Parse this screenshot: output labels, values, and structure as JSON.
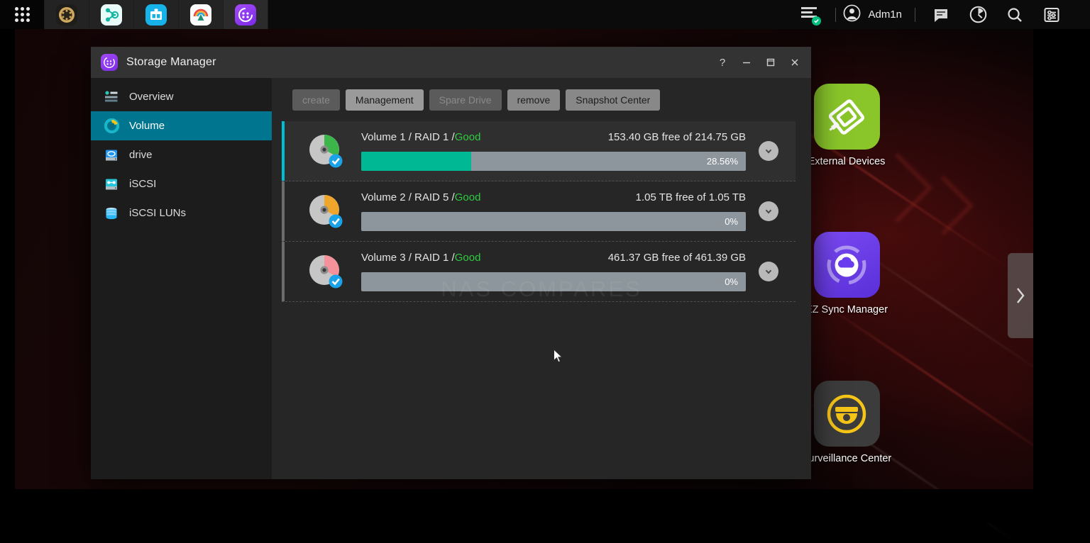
{
  "taskbar": {
    "app_icons": [
      {
        "name": "app-menu-grid-icon",
        "label": "Main Menu"
      },
      {
        "name": "control-panel-icon",
        "label": "Control Panel"
      },
      {
        "name": "network-topology-icon",
        "label": "Network"
      },
      {
        "name": "app-center-icon",
        "label": "App Center"
      },
      {
        "name": "photo-station-icon",
        "label": "Photo Station"
      },
      {
        "name": "storage-manager-icon",
        "label": "Storage Manager"
      }
    ],
    "status_icon": "system-status-icon",
    "user": "Adm1n",
    "user_avatar_icon": "user-avatar-icon",
    "right_icons": [
      {
        "name": "chat-icon",
        "label": "Notifications"
      },
      {
        "name": "resource-monitor-icon",
        "label": "Resource Monitor"
      },
      {
        "name": "search-icon",
        "label": "Search"
      },
      {
        "name": "settings-icon",
        "label": "Settings"
      }
    ]
  },
  "desktop": {
    "icons": [
      {
        "name": "external-devices",
        "label": "External Devices",
        "icon": "usb-device-icon",
        "color": "#8ac62a"
      },
      {
        "name": "ez-sync-manager",
        "label": "EZ Sync Manager",
        "icon": "cloud-sync-icon",
        "color": "#6a3df0"
      },
      {
        "name": "surveillance-center",
        "label": "Surveillance Center",
        "icon": "dome-camera-icon",
        "color": "#3c3c3c"
      }
    ],
    "edge_handle_icon": "chevron-right-icon"
  },
  "window": {
    "title": "Storage Manager",
    "app_icon": "storage-manager-icon",
    "controls": {
      "help": "?",
      "minimize": "—",
      "maximize": "☐",
      "close": "✕"
    },
    "watermark": "NAS COMPARES"
  },
  "sidebar": {
    "items": [
      {
        "label": "Overview",
        "icon": "overview-icon",
        "selected": false
      },
      {
        "label": "Volume",
        "icon": "volume-icon",
        "selected": true
      },
      {
        "label": "drive",
        "icon": "drive-icon",
        "selected": false
      },
      {
        "label": "iSCSI",
        "icon": "iscsi-icon",
        "selected": false
      },
      {
        "label": "iSCSI LUNs",
        "icon": "iscsi-lun-icon",
        "selected": false
      }
    ]
  },
  "toolbar": {
    "buttons": [
      {
        "label": "create",
        "state": "disabled"
      },
      {
        "label": "Management",
        "state": "enabled"
      },
      {
        "label": "Spare Drive",
        "state": "disabled"
      },
      {
        "label": "remove",
        "state": "mid"
      },
      {
        "label": "Snapshot Center",
        "state": "mid"
      }
    ]
  },
  "volumes": [
    {
      "name": "Volume 1 / RAID 1 / ",
      "status": "Good",
      "capacity": "153.40 GB free of 214.75 GB",
      "percent_label": "28.56%",
      "percent_value": 28.56,
      "wedge_color": "#3cb54a",
      "selected": true,
      "expand_icon": "chevron-down-icon"
    },
    {
      "name": "Volume 2 / RAID 5 / ",
      "status": "Good",
      "capacity": "1.05 TB free of 1.05 TB",
      "percent_label": "0%",
      "percent_value": 0,
      "wedge_color": "#f0a62a",
      "selected": false,
      "expand_icon": "chevron-down-icon"
    },
    {
      "name": "Volume 3 / RAID 1 / ",
      "status": "Good",
      "capacity": "461.37 GB free of 461.39 GB",
      "percent_label": "0%",
      "percent_value": 0,
      "wedge_color": "#f4919a",
      "selected": false,
      "expand_icon": "chevron-down-icon"
    }
  ],
  "colors": {
    "sidebar_selected": "#00758f",
    "progress_fill": "#00b894",
    "progress_track": "#8d969c",
    "status_good": "#2ecc40",
    "row_accent": "#00bcd4"
  }
}
